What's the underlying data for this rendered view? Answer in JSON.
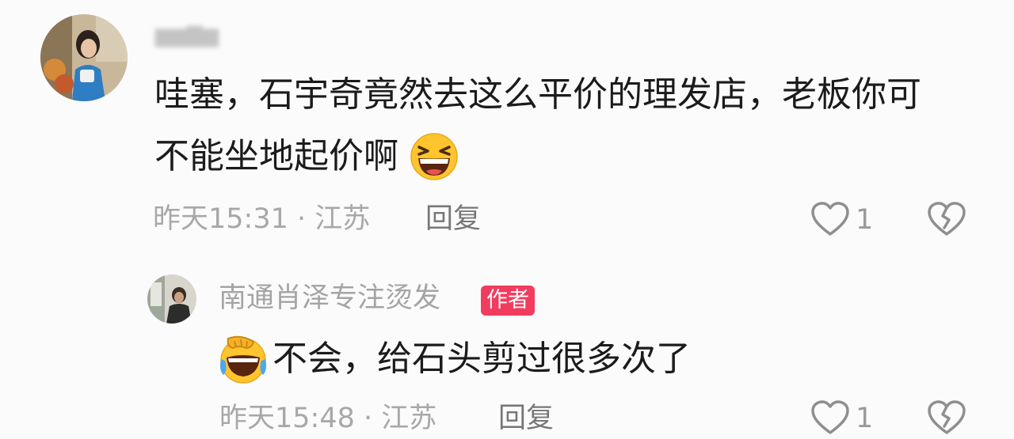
{
  "comment": {
    "text_line1": "哇塞，石宇奇竟然去这么平价的理发店，老板你可",
    "text_line2": "不能坐地起价啊",
    "time": "昨天15:31 · 江苏",
    "reply_label": "回复",
    "likes": "1",
    "emoji": "laughing-face",
    "reply": {
      "username": "南通肖泽专注烫发",
      "badge": "作者",
      "text": "不会，给石头剪过很多次了",
      "emoji": "face-palm-crying-laughing",
      "time": "昨天15:48 · 江苏",
      "reply_label": "回复",
      "likes": "1"
    }
  },
  "colors": {
    "background": "#fbfbfb",
    "badge": "#f23c5e",
    "meta_text": "#a8a8a8",
    "emoji_yellow": "#ffc42e"
  }
}
